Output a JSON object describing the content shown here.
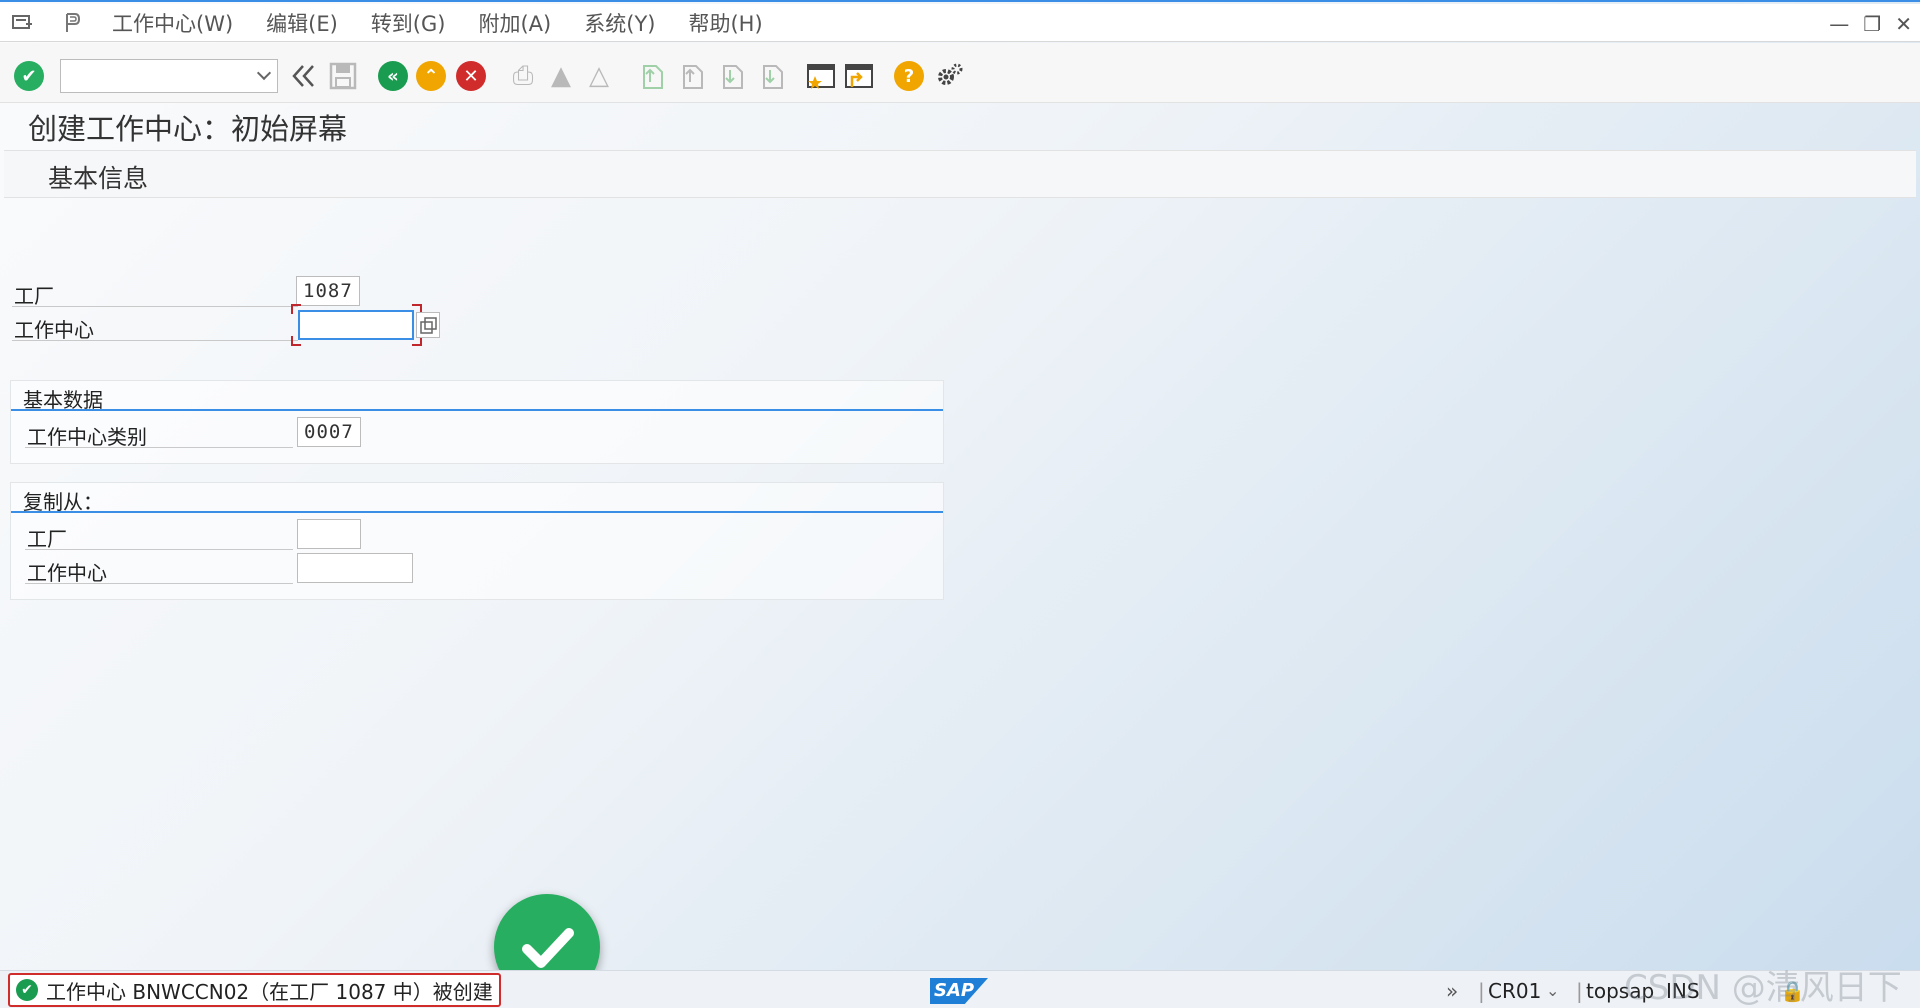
{
  "menu": {
    "items": [
      "工作中心(W)",
      "编辑(E)",
      "转到(G)",
      "附加(A)",
      "系统(Y)",
      "帮助(H)"
    ]
  },
  "toolbar": {
    "command_value": "",
    "icons": [
      "enter-icon",
      "back-icon",
      "save-icon",
      "back-green-icon",
      "exit-icon",
      "cancel-icon",
      "print-icon",
      "find-icon",
      "find-next-icon",
      "first-page-icon",
      "prev-page-icon",
      "next-page-icon",
      "last-page-icon",
      "create-session-icon",
      "shortcut-icon",
      "help-icon",
      "settings-icon"
    ]
  },
  "page": {
    "title": "创建工作中心：初始屏幕",
    "subtitle": "基本信息"
  },
  "form": {
    "plant_label": "工厂",
    "plant_value": "1087",
    "work_center_label": "工作中心",
    "work_center_value": ""
  },
  "basic_data": {
    "title": "基本数据",
    "category_label": "工作中心类别",
    "category_value": "0007"
  },
  "copy_from": {
    "title": "复制从：",
    "plant_label": "工厂",
    "plant_value": "",
    "work_center_label": "工作中心",
    "work_center_value": ""
  },
  "status": {
    "message": "工作中心 BNWCCN02（在工厂 1087 中）被创建",
    "message_type": "success",
    "transaction": "CR01",
    "server": "topsap",
    "mode": "INS",
    "watermark": "CSDN @清风日下"
  },
  "colors": {
    "accent": "#3a8ee6",
    "success": "#27ae60",
    "error_red": "#d12c2c",
    "warning": "#f0a500"
  }
}
